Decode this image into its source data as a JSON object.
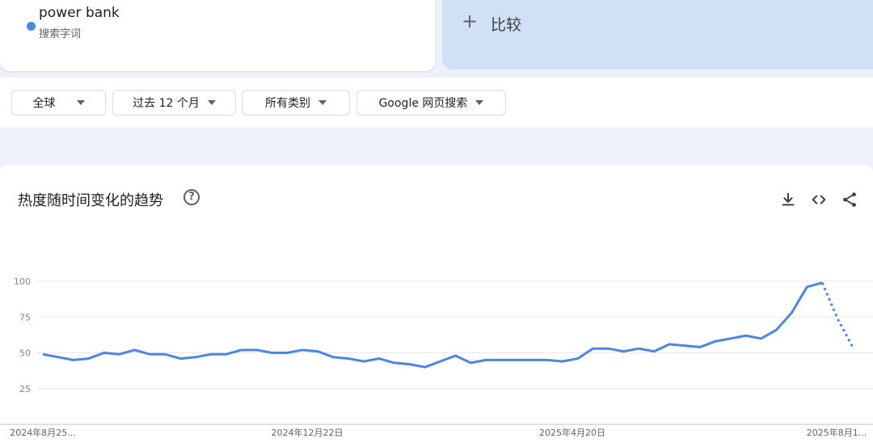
{
  "term": {
    "name": "power bank",
    "type": "搜索字词",
    "color": "#4a86e8"
  },
  "compare": {
    "icon": "plus-icon",
    "label": "比较"
  },
  "filters": [
    {
      "label": "全球"
    },
    {
      "label": "过去 12 个月"
    },
    {
      "label": "所有类别"
    },
    {
      "label": "Google 网页搜索"
    }
  ],
  "chart_header": {
    "title": "热度随时间变化的趋势",
    "help_icon": "help-circle-icon",
    "help_glyph": "?",
    "tools": [
      "download-icon",
      "embed-code-icon",
      "share-icon"
    ]
  },
  "chart_data": {
    "type": "line",
    "title": "热度随时间变化的趋势",
    "xlabel": "",
    "ylabel": "",
    "ylim": [
      0,
      100
    ],
    "yticks": [
      25,
      50,
      75,
      100
    ],
    "grid": true,
    "x_tick_labels": [
      "2024年8月25...",
      "2024年12月22日",
      "2025年4月20日",
      "2025年8月1..."
    ],
    "series": [
      {
        "name": "power bank",
        "color": "#4a86e8",
        "values": [
          49,
          47,
          45,
          46,
          50,
          49,
          52,
          49,
          49,
          46,
          47,
          49,
          49,
          52,
          52,
          50,
          50,
          52,
          51,
          47,
          46,
          44,
          46,
          43,
          42,
          40,
          44,
          48,
          43,
          45,
          45,
          45,
          45,
          45,
          44,
          46,
          53,
          53,
          51,
          53,
          51,
          56,
          55,
          54,
          58,
          60,
          62,
          60,
          66,
          78,
          96,
          99,
          74,
          54
        ],
        "partial_last_points": 2
      }
    ]
  }
}
